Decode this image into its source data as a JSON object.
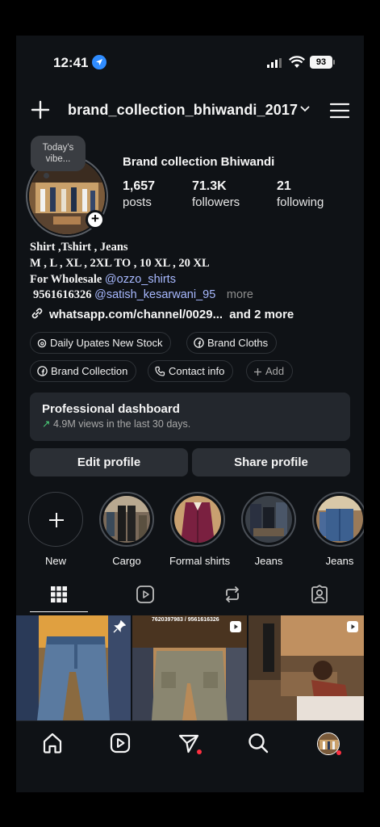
{
  "status_bar": {
    "time": "12:41",
    "battery": "93"
  },
  "header": {
    "username": "brand_collection_bhiwandi_2017"
  },
  "profile": {
    "note": "Today's vibe...",
    "name": "Brand collection Bhiwandi",
    "posts_count": "1,657",
    "posts_label": "posts",
    "followers_count": "71.3K",
    "followers_label": "followers",
    "following_count": "21",
    "following_label": "following"
  },
  "bio": {
    "line1": "Shirt ,Tshirt , Jeans",
    "line2": "M , L , XL , 2XL TO , 10 XL , 20 XL",
    "line3_text": "For Wholesale",
    "line3_mention": "@ozzo_shirts",
    "line4_phone": "9561616326",
    "line4_mention": "@satish_kesarwani_95",
    "line4_more": "more",
    "link": "whatsapp.com/channel/0029...",
    "link_more": "and 2 more"
  },
  "chips": [
    "Daily Upates New Stock",
    "Brand Cloths",
    "Brand Collection",
    "Contact info",
    "Add"
  ],
  "dashboard": {
    "title": "Professional dashboard",
    "subtitle": "4.9M views in the last 30 days."
  },
  "buttons": {
    "edit": "Edit profile",
    "share": "Share profile"
  },
  "highlights": [
    "New",
    "Cargo",
    "Formal shirts",
    "Jeans",
    "Jeans"
  ],
  "grid_post_captions": {
    "post2_phone": "7620397983 / 9561616326"
  },
  "icons": {
    "location": "location-arrow-icon",
    "cellular": "cellular-signal-icon",
    "wifi": "wifi-icon",
    "create": "plus-icon",
    "menu": "hamburger-menu-icon",
    "link": "link-icon",
    "tabs": [
      "grid-icon",
      "reels-icon",
      "reposts-icon",
      "tagged-icon"
    ],
    "nav": [
      "home-icon",
      "reels-icon",
      "messages-icon",
      "search-icon",
      "profile-avatar"
    ]
  },
  "colors": {
    "background": "#0f1216",
    "mention": "#a8b9ff",
    "accent_blue": "#2f8cff",
    "notification_red": "#ff3040",
    "growth_green": "#4cd17a"
  }
}
